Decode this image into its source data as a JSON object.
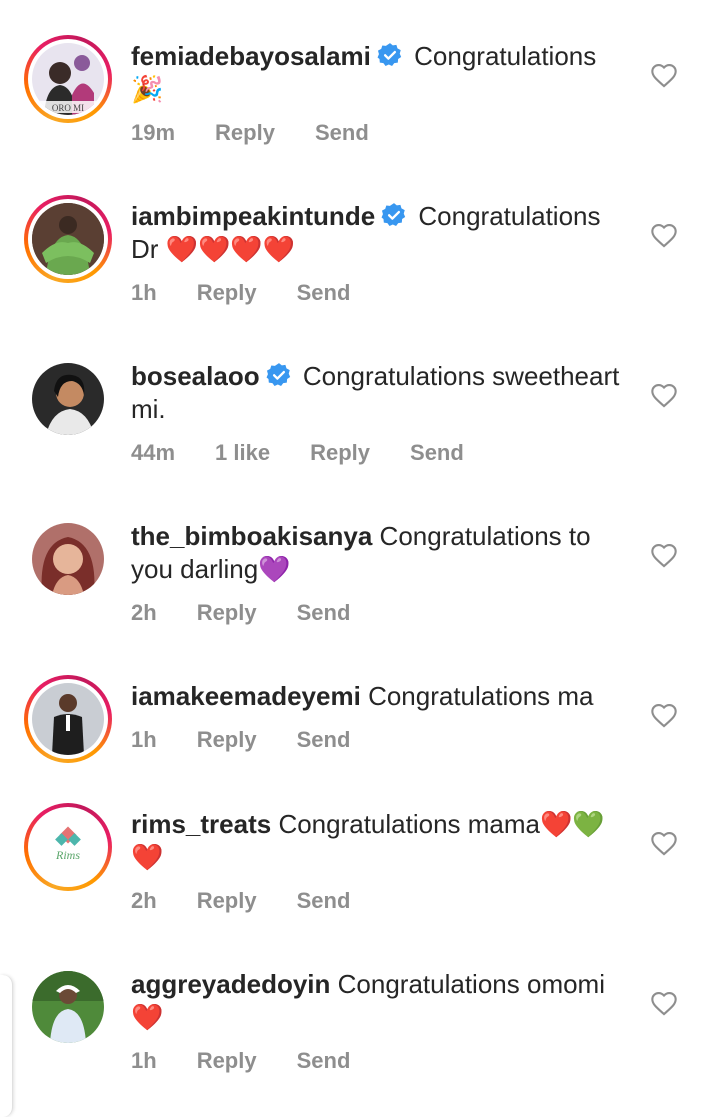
{
  "comments": [
    {
      "username": "femiadebayosalami",
      "verified": true,
      "story_ring": true,
      "text": "Congratulations",
      "emoji": "🎉",
      "time": "19m",
      "likes": "",
      "reply": "Reply",
      "send": "Send",
      "avatar_caption": "ORO MI"
    },
    {
      "username": "iambimpeakintunde",
      "verified": true,
      "story_ring": true,
      "text": "Congratulations Dr",
      "emoji": "❤️❤️❤️❤️",
      "time": "1h",
      "likes": "",
      "reply": "Reply",
      "send": "Send"
    },
    {
      "username": "bosealaoo",
      "verified": true,
      "story_ring": false,
      "text": "Congratulations sweetheart mi.",
      "emoji": "",
      "time": "44m",
      "likes": "1 like",
      "reply": "Reply",
      "send": "Send"
    },
    {
      "username": "the_bimboakisanya",
      "verified": false,
      "story_ring": false,
      "text": "Congratulations to you darling",
      "emoji": "💜",
      "time": "2h",
      "likes": "",
      "reply": "Reply",
      "send": "Send"
    },
    {
      "username": "iamakeemadeyemi",
      "verified": false,
      "story_ring": true,
      "text": "Congratulations ma",
      "emoji": "",
      "time": "1h",
      "likes": "",
      "reply": "Reply",
      "send": "Send"
    },
    {
      "username": "rims_treats",
      "verified": false,
      "story_ring": true,
      "text": "Congratulations mama",
      "emoji": "❤️💚❤️",
      "time": "2h",
      "likes": "",
      "reply": "Reply",
      "send": "Send",
      "avatar_caption": "Rims"
    },
    {
      "username": "aggreyadedoyin",
      "verified": false,
      "story_ring": false,
      "text": "Congratulations omomi",
      "emoji": "❤️",
      "time": "1h",
      "likes": "",
      "reply": "Reply",
      "send": "Send"
    }
  ],
  "icons": {
    "verified": "verified-badge-icon",
    "like": "heart-outline-icon"
  },
  "colors": {
    "verified_blue": "#3897f0",
    "meta_gray": "#8e8e8e",
    "text": "#262626"
  }
}
